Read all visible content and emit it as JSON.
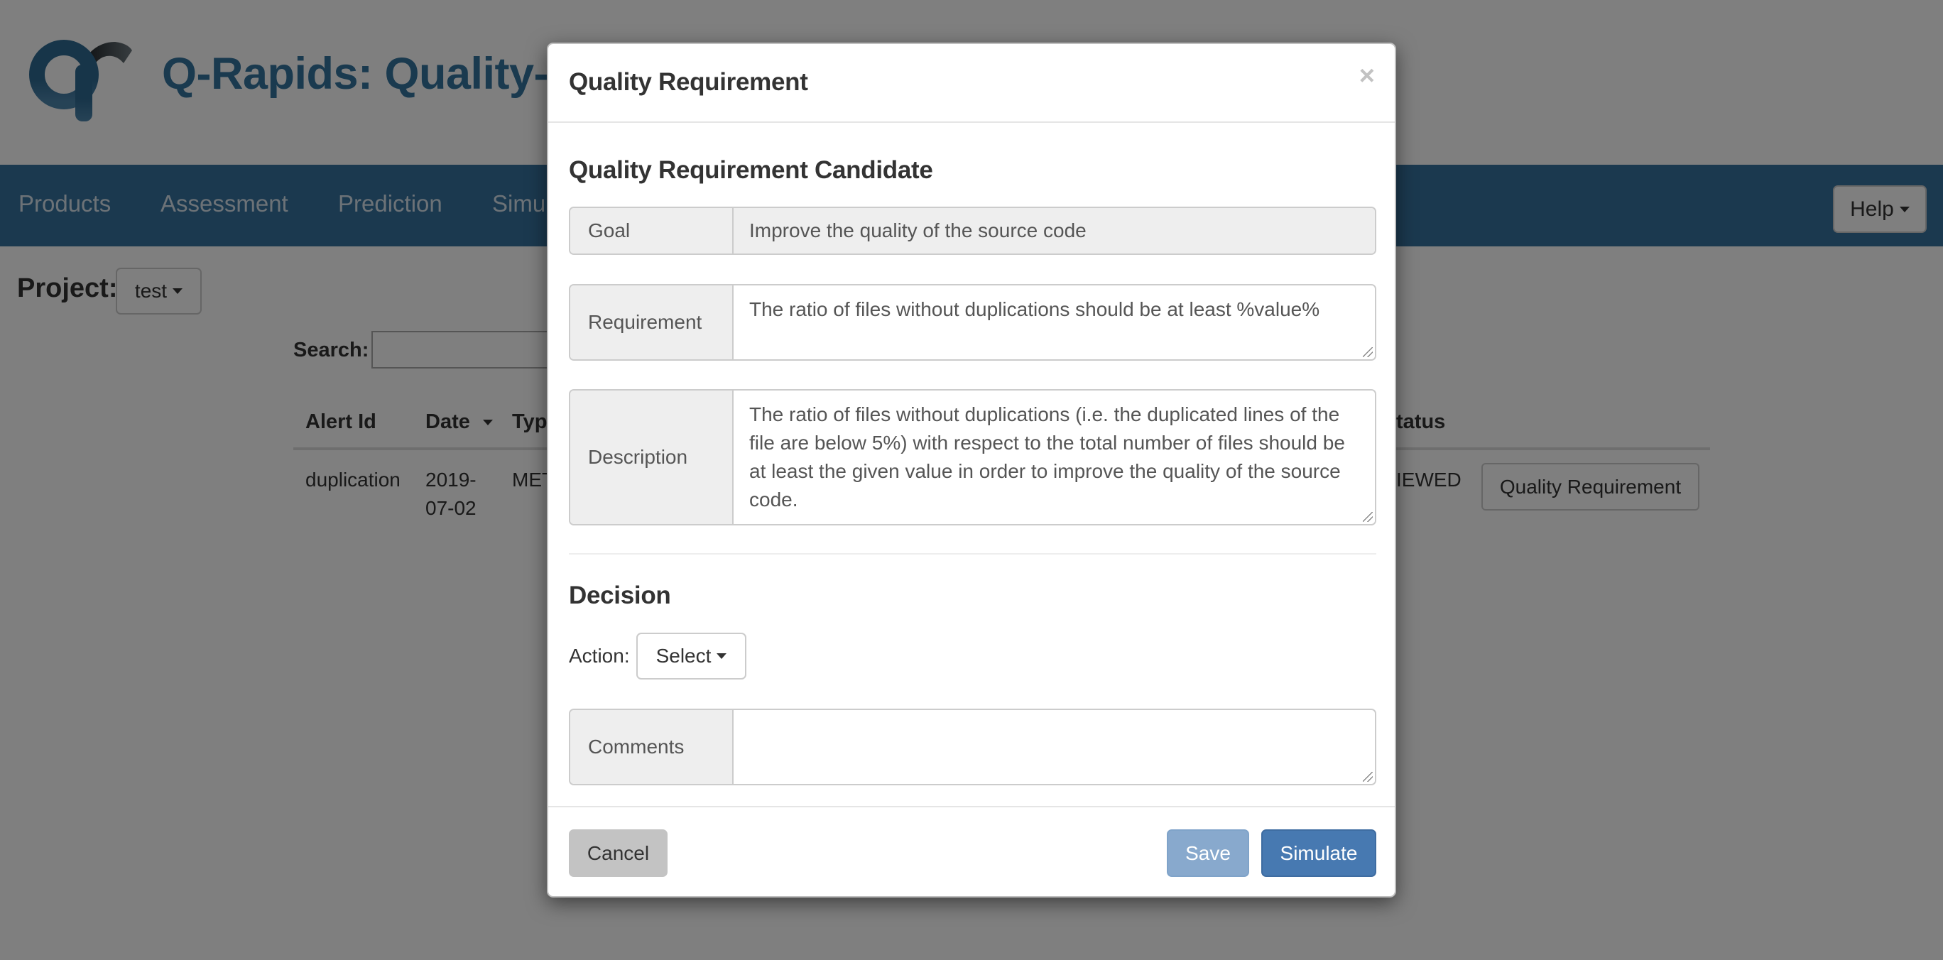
{
  "app": {
    "title": "Q-Rapids: Quality-aware rapid software development",
    "visible_title": "Q-Rapids: Quality-a"
  },
  "navbar": {
    "items": [
      {
        "label": "Products"
      },
      {
        "label": "Assessment"
      },
      {
        "label": "Prediction"
      },
      {
        "label": "Simu"
      }
    ],
    "help_label": "Help"
  },
  "project": {
    "label": "Project:",
    "selected": "test"
  },
  "search": {
    "label": "Search:",
    "value": ""
  },
  "table": {
    "columns": [
      {
        "label": "Alert Id"
      },
      {
        "label": "Date",
        "sorted": "desc"
      },
      {
        "label": "Typ"
      },
      {
        "label": "tatus"
      }
    ],
    "rows": [
      {
        "alert_id": "duplication",
        "date_line1": "2019-",
        "date_line2": "07-02",
        "type": "MET",
        "status": "IEWED",
        "action_label": "Quality Requirement"
      }
    ]
  },
  "modal": {
    "title": "Quality Requirement",
    "close_icon": "×",
    "candidate": {
      "heading": "Quality Requirement Candidate",
      "goal": {
        "label": "Goal",
        "value": "Improve the quality of the source code"
      },
      "requirement": {
        "label": "Requirement",
        "value": "The ratio of files without duplications should be at least %value%"
      },
      "description": {
        "label": "Description",
        "value": "The ratio of files without duplications (i.e. the duplicated lines of the file are below 5%) with respect to the total number of files should be at least the given value in order to improve the quality of the source code."
      }
    },
    "decision": {
      "heading": "Decision",
      "action_label": "Action:",
      "action_selected": "Select",
      "comments": {
        "label": "Comments",
        "value": ""
      }
    },
    "footer": {
      "cancel_label": "Cancel",
      "save_label": "Save",
      "simulate_label": "Simulate"
    }
  },
  "colors": {
    "brand": "#34759f",
    "navbar": "#36739f",
    "primary_button": "#4779b1",
    "disabled_primary": "#88a9cd",
    "cancel_button": "#c3c3c3",
    "backdrop": "rgba(0,0,0,0.5)"
  }
}
